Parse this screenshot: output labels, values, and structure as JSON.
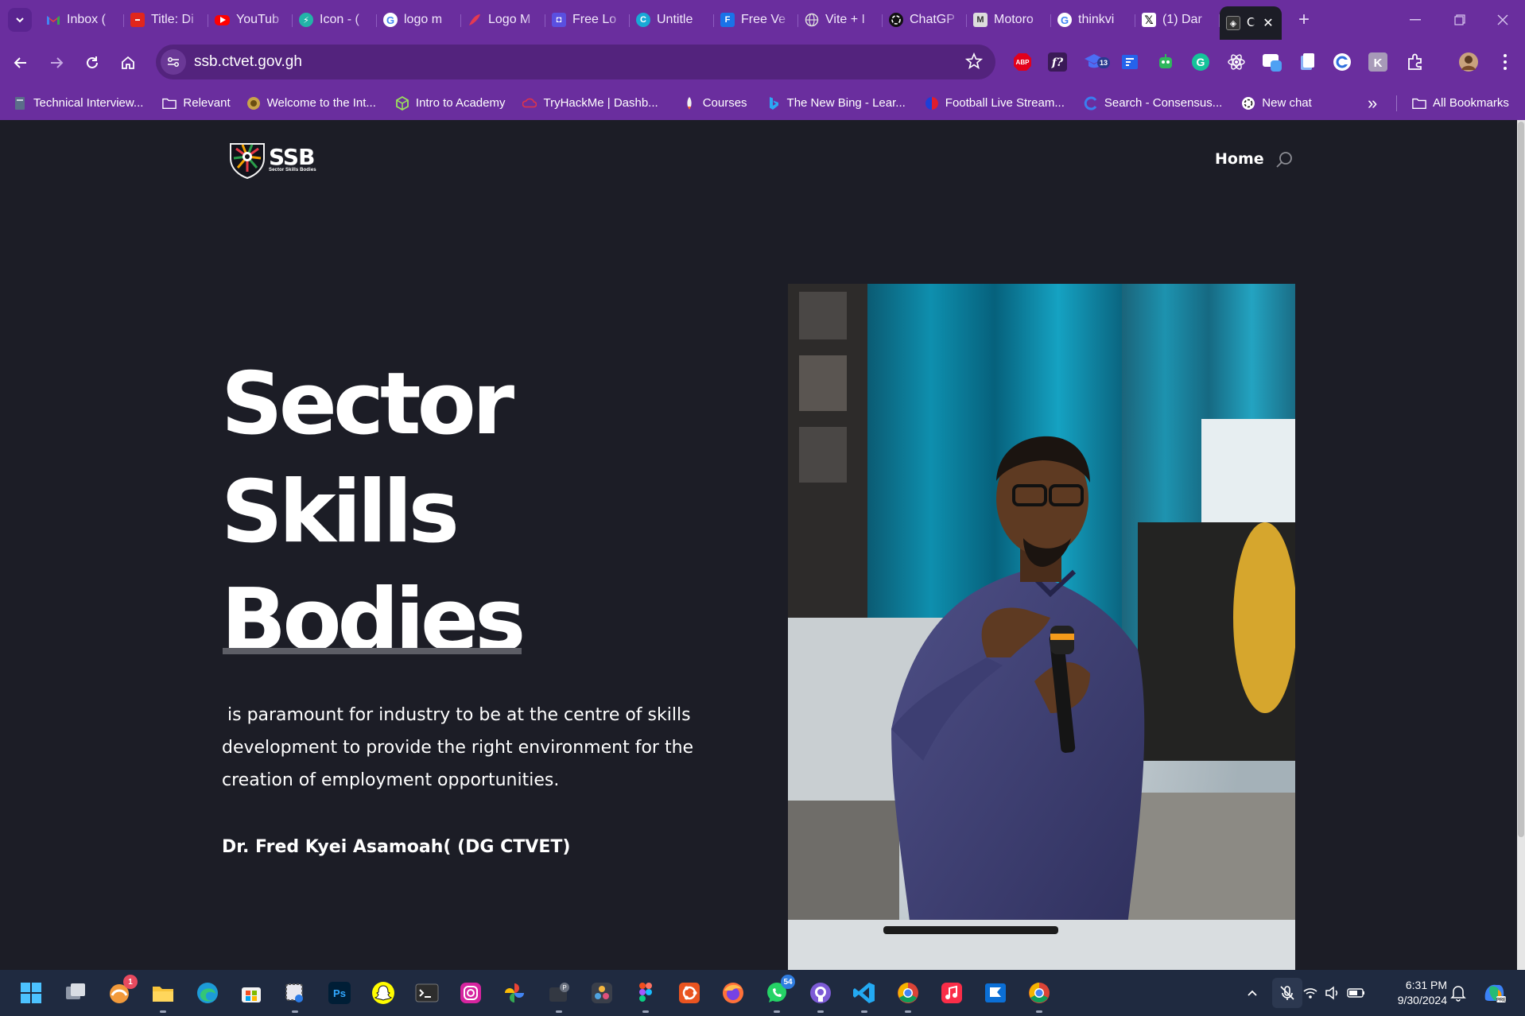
{
  "browser": {
    "tabs": [
      {
        "label": "Inbox (",
        "icon": "gmail-icon",
        "color": "#ea4335"
      },
      {
        "label": "Title: Di",
        "icon": "red-card-icon",
        "color": "#e1261c"
      },
      {
        "label": "YouTub",
        "icon": "youtube-icon",
        "color": "#ff0000"
      },
      {
        "label": "Icon - (",
        "icon": "bolt-icon",
        "color": "#23b3a8"
      },
      {
        "label": "logo m",
        "icon": "google-icon",
        "color": "#4285f4"
      },
      {
        "label": "Logo M",
        "icon": "pen-logo-icon",
        "color": "#e53950"
      },
      {
        "label": "Free Lo",
        "icon": "square-logo-icon",
        "color": "#5a4fe0"
      },
      {
        "label": "Untitle",
        "icon": "canva-icon",
        "color": "#18a9d6"
      },
      {
        "label": "Free Ve",
        "icon": "f-logo-icon",
        "color": "#1a73e8"
      },
      {
        "label": "Vite + I",
        "icon": "globe-icon",
        "color": "#9aa0a6"
      },
      {
        "label": "ChatGP",
        "icon": "openai-icon",
        "color": "#111111"
      },
      {
        "label": "Motoro",
        "icon": "motorola-icon",
        "color": "#dddddd"
      },
      {
        "label": "thinkvi",
        "icon": "google-icon",
        "color": "#4285f4"
      },
      {
        "label": "(1) Dar",
        "icon": "x-icon",
        "color": "#000000"
      },
      {
        "label": "CT",
        "icon": "ctvet-icon",
        "color": "#333333",
        "active": true
      }
    ],
    "new_tab_label": "+",
    "close_tab_label": "✕"
  },
  "toolbar": {
    "url": "ssb.ctvet.gov.gh",
    "ext_badge": "13"
  },
  "bookmarks": {
    "items": [
      {
        "label": "Technical Interview...",
        "icon": "page-icon"
      },
      {
        "label": "Relevant",
        "icon": "folder-icon"
      },
      {
        "label": "Welcome to the Int...",
        "icon": "emblem-icon"
      },
      {
        "label": "Intro to Academy",
        "icon": "cube-icon"
      },
      {
        "label": "TryHackMe | Dashb...",
        "icon": "tryhackme-icon"
      },
      {
        "label": "Courses",
        "icon": "rocket-icon"
      },
      {
        "label": "The New Bing - Lear...",
        "icon": "bing-icon"
      },
      {
        "label": "Football Live Stream...",
        "icon": "football-icon"
      },
      {
        "label": "Search - Consensus...",
        "icon": "consensus-icon"
      },
      {
        "label": "New chat",
        "icon": "openai-icon"
      }
    ],
    "overflow_label": "»",
    "all_bookmarks_label": "All Bookmarks"
  },
  "site": {
    "logo_text": "SSB",
    "logo_subtitle": "Sector Skills Bodies",
    "nav_home": "Home",
    "hero": {
      "title_lines": [
        "Sector",
        "Skills",
        "Bodies"
      ],
      "description": " is paramount for industry to be at the centre of skills development to provide the right environment for the creation of employment opportunities.",
      "author": "Dr. Fred Kyei Asamoah( (DG CTVET)"
    }
  },
  "taskbar": {
    "apps_badge_1": "1",
    "whatsapp_badge": "54",
    "time": "6:31 PM",
    "date": "9/30/2024"
  },
  "colors": {
    "browser_frame": "#6a2e9e",
    "page_background": "#1c1d26",
    "taskbar": "#1f2a40"
  }
}
